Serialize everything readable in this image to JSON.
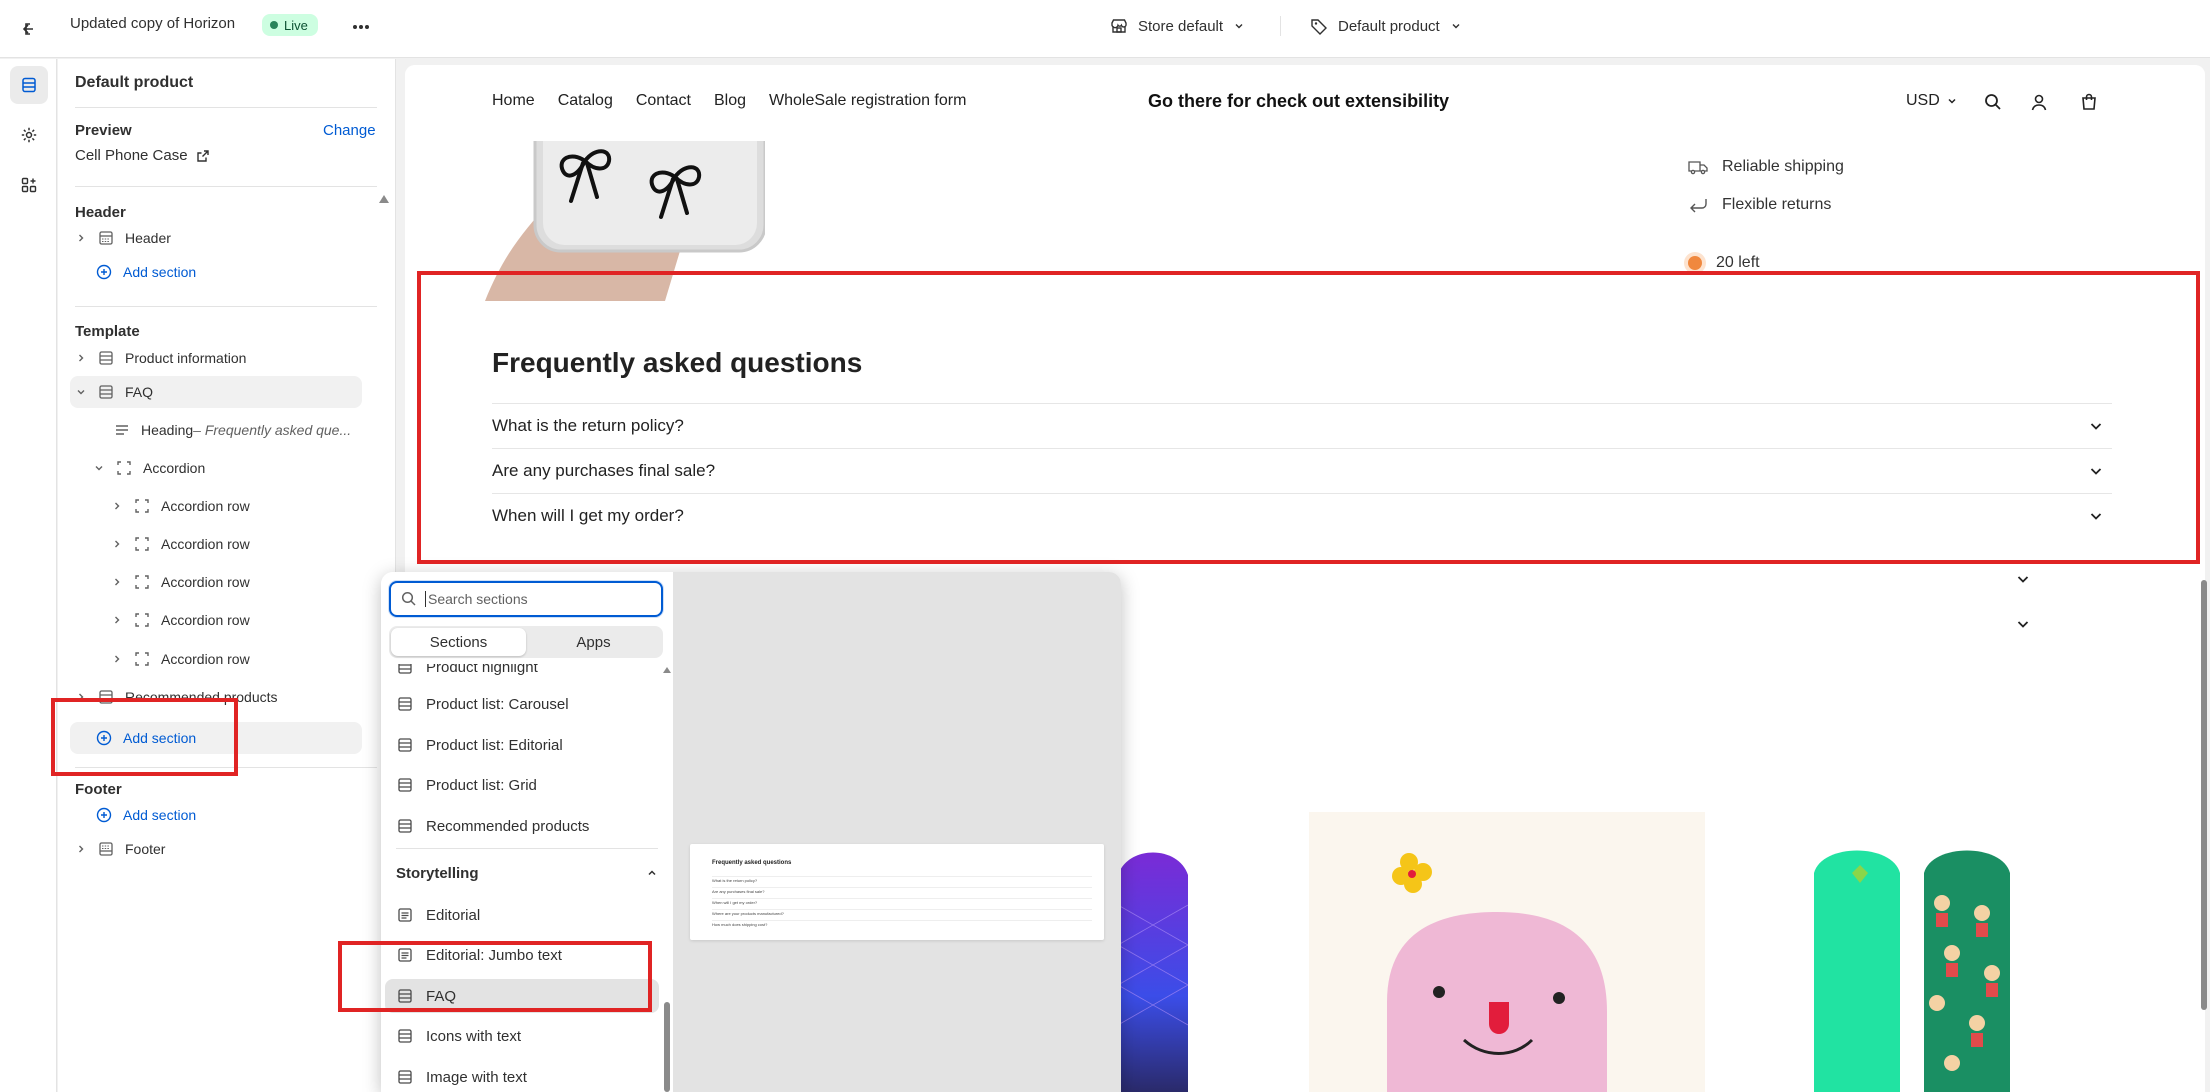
{
  "topbar": {
    "theme_title": "Updated copy of Horizon",
    "live_badge": "Live",
    "store_selector": "Store default",
    "template_selector": "Default product"
  },
  "sidebar": {
    "title": "Default product",
    "preview_label": "Preview",
    "change_link": "Change",
    "preview_product": "Cell Phone Case",
    "header_group": "Header",
    "header_item": "Header",
    "add_section": "Add section",
    "template_group": "Template",
    "product_information": "Product information",
    "faq": "FAQ",
    "heading_block": "Heading",
    "heading_block_detail": " – Frequently asked que...",
    "accordion": "Accordion",
    "accordion_rows": [
      "Accordion row",
      "Accordion row",
      "Accordion row",
      "Accordion row",
      "Accordion row"
    ],
    "recommended_products": "Recommended products",
    "footer_group": "Footer",
    "footer_item": "Footer"
  },
  "storefront": {
    "nav_links": [
      "Home",
      "Catalog",
      "Contact",
      "Blog",
      "WholeSale registration form"
    ],
    "brand": "Go there for check out extensibility",
    "currency": "USD",
    "shipping": "Reliable shipping",
    "returns": "Flexible returns",
    "stock": "20 left",
    "faq_title": "Frequently asked questions",
    "faq_questions": [
      "What is the return policy?",
      "Are any purchases final sale?",
      "When will I get my order?"
    ]
  },
  "picker": {
    "search_placeholder": "Search sections",
    "tab_sections": "Sections",
    "tab_apps": "Apps",
    "partial_item": "Product highlight",
    "items_top": [
      "Product list: Carousel",
      "Product list: Editorial",
      "Product list: Grid",
      "Recommended products"
    ],
    "category": "Storytelling",
    "items_storytelling": [
      "Editorial",
      "Editorial: Jumbo text",
      "FAQ",
      "Icons with text",
      "Image with text"
    ],
    "selected_item": "FAQ",
    "thumbnail": {
      "title": "Frequently asked questions",
      "rows": [
        "What is the return policy?",
        "Are any purchases final sale?",
        "When will I get my order?",
        "Where are your products manufactured?",
        "How much does shipping cost?"
      ]
    }
  },
  "colors": {
    "accent_blue": "#005bd3",
    "live_green": "#29845a",
    "annotation_red": "#e02424"
  }
}
